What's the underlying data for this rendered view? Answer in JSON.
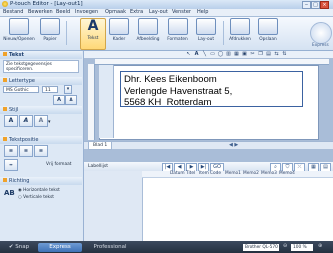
{
  "window": {
    "title": "P-touch Editor - [Lay-out1]",
    "minimize": "‒",
    "maximize": "□",
    "close": "×"
  },
  "menu": [
    "Bestand",
    "Bewerken",
    "Beeld",
    "Invoegen",
    "Opmaak",
    "Extra",
    "Lay-out",
    "Venster",
    "Help"
  ],
  "ribbon": {
    "buttons": [
      "Nieuw/Openen",
      "Papier",
      "Tekst",
      "Kader",
      "Afbeelding",
      "Formaten",
      "Lay-out",
      "Afdrukken",
      "Opslaan"
    ],
    "express": "Express",
    "selected": "Tekst"
  },
  "panel": {
    "header": "Tekst",
    "tip": "Zie tekstgegevensjes specificeren.",
    "font_section": "Lettertype",
    "font_name": "MS Gothic",
    "font_size": "11",
    "style_section": "Stijl",
    "align_section": "Tekstpositie",
    "align_label": "Vrij formaat",
    "direction_section": "Richting",
    "dir_sample": "AB",
    "dir_horizontal": "Horizontale tekst",
    "dir_vertical": "Verticale tekst"
  },
  "label": {
    "lines": [
      "Dhr. Kees Eikenboom",
      "Verlengde Havenstraat 5,",
      "5568 KH  Rotterdam"
    ]
  },
  "sheet": {
    "tab": "Blad 1"
  },
  "database": {
    "left_label": "Labellijst",
    "columns": [
      "Datum",
      "Titel",
      "Item",
      "Code",
      "Memo1",
      "Memo2",
      "Memo3",
      "Memo4"
    ],
    "search_label": "GO"
  },
  "status": {
    "tabs": [
      "Snap",
      "Express",
      "Professional"
    ],
    "printer": "Brother QL-570",
    "zoom": "100 %"
  },
  "colors": {
    "accent": "#3f72b6",
    "ribbon_selected": "#ffd877"
  }
}
